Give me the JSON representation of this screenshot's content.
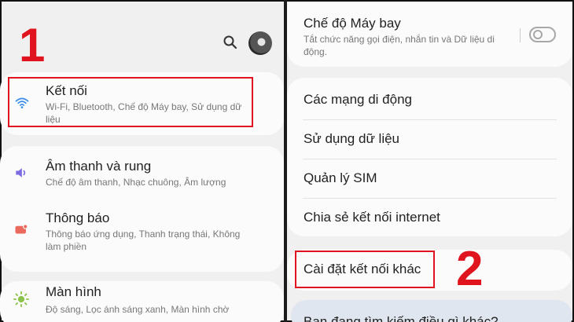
{
  "left": {
    "step_number": "1",
    "items": [
      {
        "title": "Kết nối",
        "subtitle": "Wi-Fi, Bluetooth, Chế độ Máy bay, Sử dụng dữ liệu",
        "icon": "wifi-icon"
      },
      {
        "title": "Âm thanh và rung",
        "subtitle": "Chế độ âm thanh, Nhạc chuông, Âm lượng",
        "icon": "sound-icon"
      },
      {
        "title": "Thông báo",
        "subtitle": "Thông báo ứng dụng, Thanh trạng thái, Không làm phiền",
        "icon": "notification-icon"
      },
      {
        "title": "Màn hình",
        "subtitle": "Độ sáng, Lọc ánh sáng xanh, Màn hình chờ",
        "icon": "brightness-icon"
      }
    ]
  },
  "right": {
    "step_number": "2",
    "airplane": {
      "title": "Chế độ Máy bay",
      "subtitle": "Tắt chức năng gọi điện, nhắn tin và Dữ liệu di động.",
      "enabled": false
    },
    "items": [
      {
        "title": "Các mạng di động"
      },
      {
        "title": "Sử dụng dữ liệu"
      },
      {
        "title": "Quản lý SIM"
      },
      {
        "title": "Chia sẻ kết nối internet"
      }
    ],
    "more": {
      "title": "Cài đặt kết nối khác"
    },
    "bottom_text": "Bạn đang tìm kiếm điều gì khác?"
  },
  "colors": {
    "highlight": "#e0141e",
    "wifi": "#3a8ee6",
    "sound": "#7b6be0",
    "notification": "#ea6a5d",
    "display": "#8bc34a"
  }
}
